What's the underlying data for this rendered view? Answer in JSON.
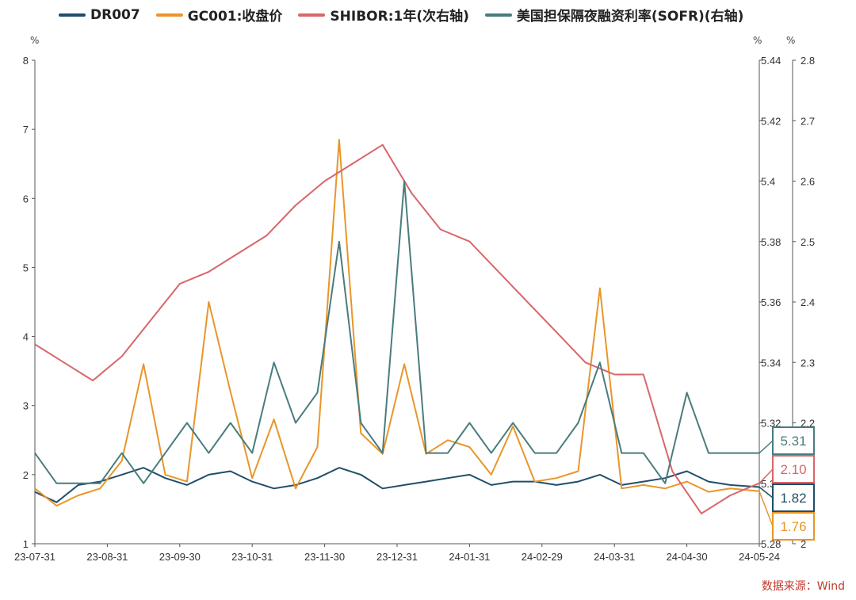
{
  "legend": [
    {
      "label": "DR007",
      "color": "#1f4e6b"
    },
    {
      "label": "GC001:收盘价",
      "color": "#e8962a"
    },
    {
      "label": "SHIBOR:1年(次右轴)",
      "color": "#d9666b"
    },
    {
      "label": "美国担保隔夜融资利率(SOFR)(右轴)",
      "color": "#4a7c7e"
    }
  ],
  "units": {
    "left": "%",
    "right1": "%",
    "right2": "%"
  },
  "source": "数据来源：Wind",
  "chart_data": {
    "type": "line",
    "x_labels": [
      "23-07-31",
      "23-08-31",
      "23-09-30",
      "23-10-31",
      "23-11-30",
      "23-12-31",
      "24-01-31",
      "24-02-29",
      "24-03-31",
      "24-04-30",
      "24-05-24"
    ],
    "y_left": {
      "min": 1,
      "max": 8,
      "ticks": [
        1,
        2,
        3,
        4,
        5,
        6,
        7,
        8
      ]
    },
    "y_right1": {
      "min": 5.28,
      "max": 5.44,
      "ticks": [
        "5.28",
        "5.3",
        "5.32",
        "5.34",
        "5.36",
        "5.38",
        "5.4",
        "5.42",
        "5.44"
      ]
    },
    "y_right2": {
      "min": 2,
      "max": 2.8,
      "ticks": [
        "2",
        "2.1",
        "2.2",
        "2.3",
        "2.4",
        "2.5",
        "2.6",
        "2.7",
        "2.8"
      ]
    },
    "end_labels": [
      {
        "text": "5.31",
        "color": "#4a7c7e",
        "value": 5.31,
        "axis": "right1"
      },
      {
        "text": "2.10",
        "color": "#d9666b",
        "value": 2.1,
        "axis": "right2"
      },
      {
        "text": "1.82",
        "color": "#1f4e6b",
        "value": 1.82,
        "axis": "left"
      },
      {
        "text": "1.76",
        "color": "#e8962a",
        "value": 1.76,
        "axis": "left"
      }
    ],
    "series": [
      {
        "name": "DR007",
        "color": "#1f4e6b",
        "axis": "left",
        "x": [
          0,
          0.03,
          0.06,
          0.09,
          0.12,
          0.15,
          0.18,
          0.21,
          0.24,
          0.27,
          0.3,
          0.33,
          0.36,
          0.39,
          0.42,
          0.45,
          0.48,
          0.51,
          0.54,
          0.57,
          0.6,
          0.63,
          0.66,
          0.69,
          0.72,
          0.75,
          0.78,
          0.81,
          0.84,
          0.87,
          0.9,
          0.93,
          0.96,
          1.0
        ],
        "values": [
          1.75,
          1.6,
          1.85,
          1.9,
          2.0,
          2.1,
          1.95,
          1.85,
          2.0,
          2.05,
          1.9,
          1.8,
          1.85,
          1.95,
          2.1,
          2.0,
          1.8,
          1.85,
          1.9,
          1.95,
          2.0,
          1.85,
          1.9,
          1.9,
          1.85,
          1.9,
          2.0,
          1.85,
          1.9,
          1.95,
          2.05,
          1.9,
          1.85,
          1.82
        ]
      },
      {
        "name": "GC001:收盘价",
        "color": "#e8962a",
        "axis": "left",
        "x": [
          0,
          0.03,
          0.06,
          0.09,
          0.12,
          0.15,
          0.18,
          0.21,
          0.24,
          0.27,
          0.3,
          0.33,
          0.36,
          0.39,
          0.42,
          0.45,
          0.48,
          0.51,
          0.54,
          0.57,
          0.6,
          0.63,
          0.66,
          0.69,
          0.72,
          0.75,
          0.78,
          0.81,
          0.84,
          0.87,
          0.9,
          0.93,
          0.96,
          1.0
        ],
        "values": [
          1.8,
          1.55,
          1.7,
          1.8,
          2.2,
          3.6,
          2.0,
          1.9,
          4.5,
          3.2,
          1.95,
          2.8,
          1.8,
          2.4,
          6.85,
          2.6,
          2.3,
          3.6,
          2.3,
          2.5,
          2.4,
          2.0,
          2.7,
          1.9,
          1.95,
          2.05,
          4.7,
          1.8,
          1.85,
          1.8,
          1.9,
          1.75,
          1.8,
          1.76
        ]
      },
      {
        "name": "SHIBOR:1年(次右轴)",
        "color": "#d9666b",
        "axis": "right2",
        "x": [
          0,
          0.04,
          0.08,
          0.12,
          0.16,
          0.2,
          0.24,
          0.28,
          0.32,
          0.36,
          0.4,
          0.44,
          0.48,
          0.52,
          0.56,
          0.6,
          0.64,
          0.68,
          0.72,
          0.76,
          0.8,
          0.84,
          0.88,
          0.92,
          0.96,
          1.0
        ],
        "values": [
          2.33,
          2.3,
          2.27,
          2.31,
          2.37,
          2.43,
          2.45,
          2.48,
          2.51,
          2.56,
          2.6,
          2.63,
          2.66,
          2.58,
          2.52,
          2.5,
          2.45,
          2.4,
          2.35,
          2.3,
          2.28,
          2.28,
          2.12,
          2.05,
          2.08,
          2.1
        ]
      },
      {
        "name": "美国担保隔夜融资利率(SOFR)(右轴)",
        "color": "#4a7c7e",
        "axis": "right1",
        "x": [
          0,
          0.03,
          0.06,
          0.09,
          0.12,
          0.15,
          0.18,
          0.21,
          0.24,
          0.27,
          0.3,
          0.33,
          0.36,
          0.39,
          0.42,
          0.45,
          0.48,
          0.51,
          0.54,
          0.57,
          0.6,
          0.63,
          0.66,
          0.69,
          0.72,
          0.75,
          0.78,
          0.81,
          0.84,
          0.87,
          0.9,
          0.93,
          0.96,
          1.0
        ],
        "values": [
          5.31,
          5.3,
          5.3,
          5.3,
          5.31,
          5.3,
          5.31,
          5.32,
          5.31,
          5.32,
          5.31,
          5.34,
          5.32,
          5.33,
          5.38,
          5.32,
          5.31,
          5.4,
          5.31,
          5.31,
          5.32,
          5.31,
          5.32,
          5.31,
          5.31,
          5.32,
          5.34,
          5.31,
          5.31,
          5.3,
          5.33,
          5.31,
          5.31,
          5.31
        ]
      }
    ]
  }
}
